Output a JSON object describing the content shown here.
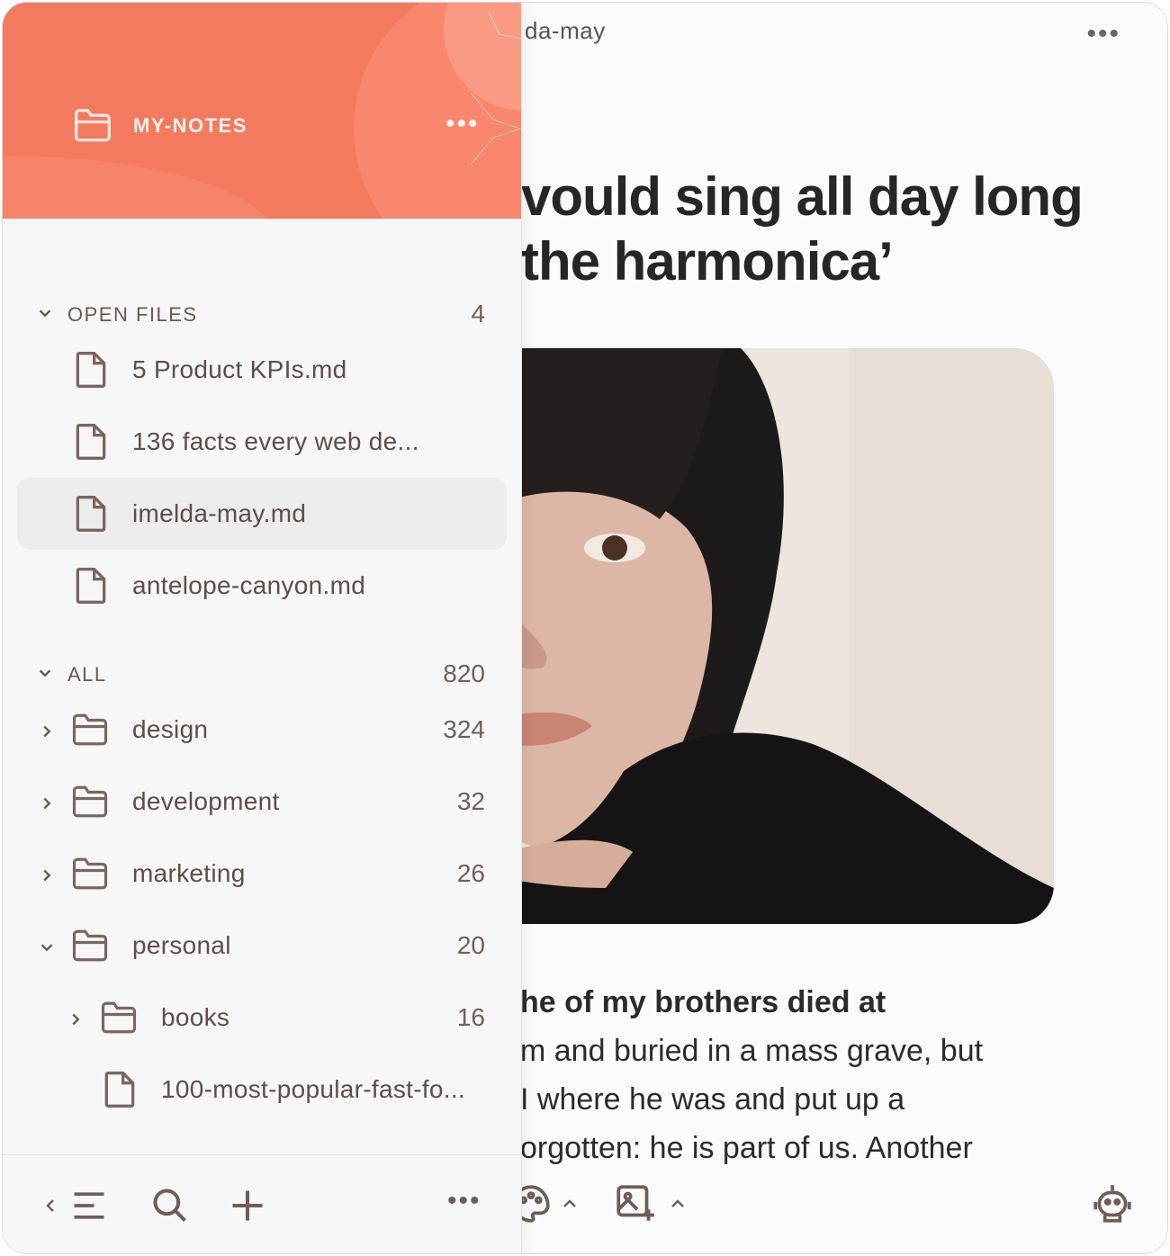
{
  "document": {
    "title": "da-may",
    "heading_line1": "vould sing all day long",
    "heading_line2": "the harmonica’",
    "body_bold": "he of my brothers died at",
    "body_lines": [
      "m and buried in a mass grave, but",
      "I where he was and put up a",
      "orgotten: he is part of us. Another"
    ],
    "more_label": "•••"
  },
  "sidebar": {
    "vault_name": "MY-NOTES",
    "vault_more": "•••",
    "open_files": {
      "label": "OPEN FILES",
      "count": "4",
      "items": [
        {
          "name": "5 Product KPIs.md"
        },
        {
          "name": "136 facts every web de..."
        },
        {
          "name": "imelda-may.md",
          "active": true
        },
        {
          "name": "antelope-canyon.md"
        }
      ]
    },
    "all": {
      "label": "ALL",
      "count": "820",
      "folders": [
        {
          "name": "design",
          "count": "324"
        },
        {
          "name": "development",
          "count": "32"
        },
        {
          "name": "marketing",
          "count": "26"
        },
        {
          "name": "personal",
          "count": "20"
        }
      ],
      "subfolder": {
        "name": "books",
        "count": "16"
      },
      "subfile": {
        "name": "100-most-popular-fast-fo..."
      }
    },
    "footer": {
      "more_label": "•••"
    }
  },
  "toolbar": {
    "icons": [
      "palette-icon",
      "image-add-icon",
      "robot-icon"
    ]
  },
  "colors": {
    "accent": "#f47a5f",
    "text": "#5e4d48"
  }
}
